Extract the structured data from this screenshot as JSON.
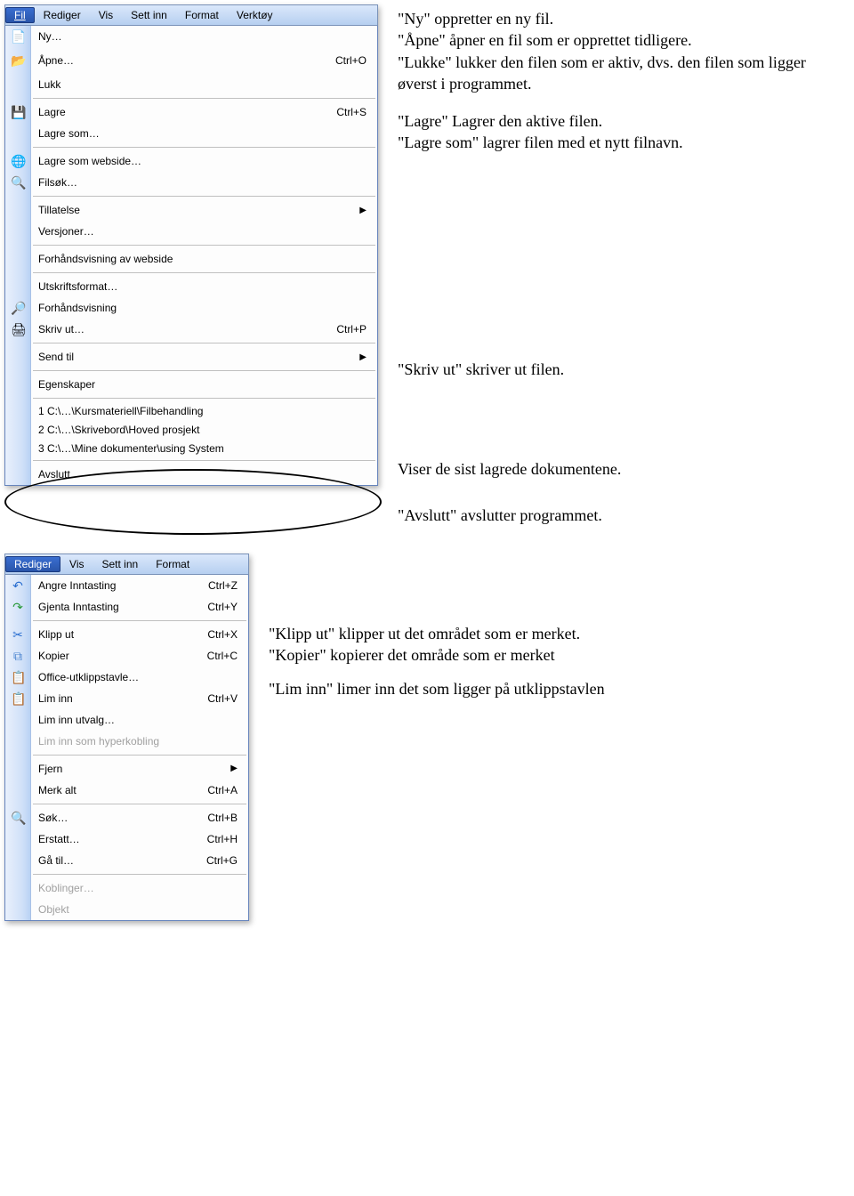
{
  "file_menu": {
    "menubar": [
      "Fil",
      "Rediger",
      "Vis",
      "Sett inn",
      "Format",
      "Verktøy"
    ],
    "items": {
      "ny": "Ny…",
      "apne": "Åpne…",
      "apne_sc": "Ctrl+O",
      "lukk": "Lukk",
      "lagre": "Lagre",
      "lagre_sc": "Ctrl+S",
      "lagresom": "Lagre som…",
      "lagreweb": "Lagre som webside…",
      "filsok": "Filsøk…",
      "tillatelse": "Tillatelse",
      "versjoner": "Versjoner…",
      "forhandweb": "Forhåndsvisning av webside",
      "utskrift": "Utskriftsformat…",
      "forhand": "Forhåndsvisning",
      "skrivut": "Skriv ut…",
      "skrivut_sc": "Ctrl+P",
      "sendtil": "Send til",
      "egenskaper": "Egenskaper",
      "mru1": "1 C:\\…\\Kursmateriell\\Filbehandling",
      "mru2": "2 C:\\…\\Skrivebord\\Hoved prosjekt",
      "mru3": "3 C:\\…\\Mine dokumenter\\using System",
      "avslutt": "Avslutt"
    }
  },
  "edit_menu": {
    "menubar": [
      "Rediger",
      "Vis",
      "Sett inn",
      "Format"
    ],
    "items": {
      "angre": "Angre Inntasting",
      "angre_sc": "Ctrl+Z",
      "gjenta": "Gjenta Inntasting",
      "gjenta_sc": "Ctrl+Y",
      "klipput": "Klipp ut",
      "klipput_sc": "Ctrl+X",
      "kopier": "Kopier",
      "kopier_sc": "Ctrl+C",
      "officeclip": "Office-utklippstavle…",
      "liminn": "Lim inn",
      "liminn_sc": "Ctrl+V",
      "liminnutvalg": "Lim inn utvalg…",
      "liminnhyper": "Lim inn som hyperkobling",
      "fjern": "Fjern",
      "merkalt": "Merk alt",
      "merkalt_sc": "Ctrl+A",
      "sok": "Søk…",
      "sok_sc": "Ctrl+B",
      "erstatt": "Erstatt…",
      "erstatt_sc": "Ctrl+H",
      "gatil": "Gå til…",
      "gatil_sc": "Ctrl+G",
      "koblinger": "Koblinger…",
      "objekt": "Objekt"
    }
  },
  "explain": {
    "ny": "\"Ny\" oppretter en ny fil.",
    "apne": "\"Åpne\" åpner en fil som er opprettet tidligere.",
    "lukke": "\"Lukke\" lukker den filen som er aktiv, dvs. den filen som ligger øverst i programmet.",
    "lagre": "\"Lagre\" Lagrer den aktive filen.",
    "lagresom": "\"Lagre som\" lagrer filen med et nytt filnavn.",
    "skrivut": "\"Skriv ut\" skriver ut filen.",
    "mru": "Viser de sist lagrede dokumentene.",
    "avslutt": "\"Avslutt\" avslutter programmet.",
    "klipput": "\"Klipp ut\" klipper ut det området som er merket.",
    "kopier": "\"Kopier\" kopierer det område som er merket",
    "liminn": "\"Lim inn\" limer inn det som ligger på utklippstavlen"
  },
  "icon_colors": {
    "new": "#ffffff",
    "open": "#f8c96a",
    "save": "#4a6fd6",
    "saveweb": "#5aa0d8",
    "search": "#5aa0d8",
    "preview": "#d0d0d0",
    "print": "#c8c8c8",
    "undo": "#3a7edb",
    "redo": "#3aa63a",
    "cut": "#4a6fd6",
    "copy": "#6aa0e0",
    "clipboard": "#e8a35a",
    "paste": "#e8c06a",
    "find": "#6aa0e0"
  }
}
